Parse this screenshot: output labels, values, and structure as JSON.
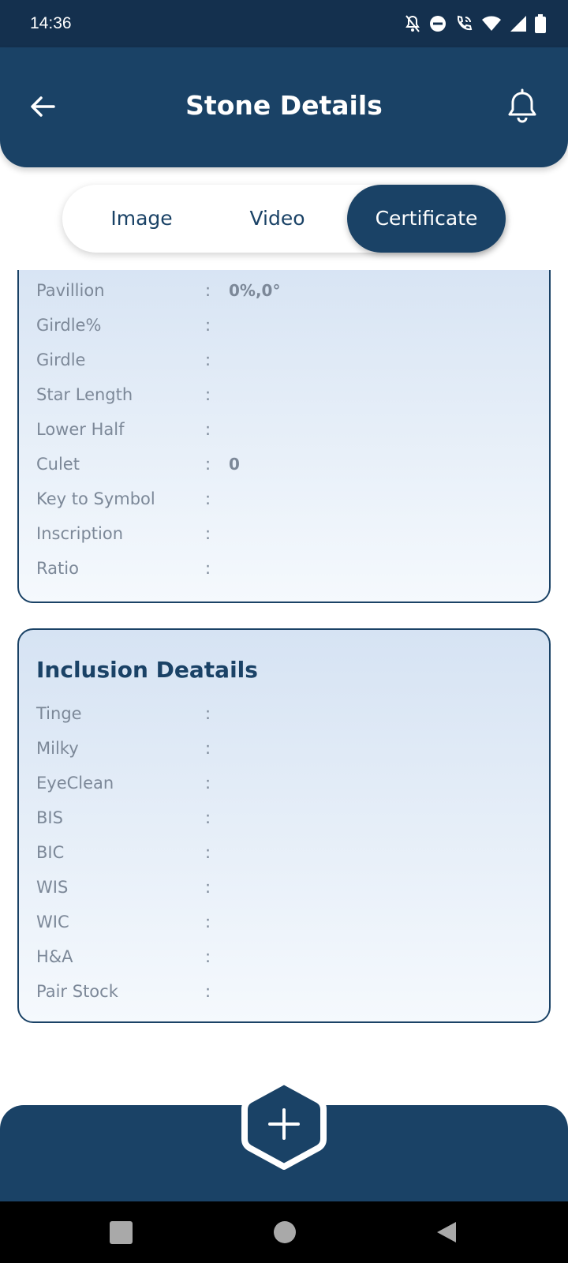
{
  "status_bar": {
    "time": "14:36",
    "icons": [
      "bell-off-icon",
      "do-not-disturb-icon",
      "wifi-call-icon",
      "wifi-icon",
      "cell-signal-icon",
      "battery-icon"
    ]
  },
  "header": {
    "title": "Stone Details",
    "back_icon": "arrow-left-icon",
    "notification_icon": "bell-icon"
  },
  "tabs": {
    "items": [
      {
        "label": "Image",
        "selected": false
      },
      {
        "label": "Video",
        "selected": false
      },
      {
        "label": "Certificate",
        "selected": true
      }
    ]
  },
  "measurements_card": {
    "rows": [
      {
        "label": "Pavillion",
        "colon": ":",
        "value": "0%,0°"
      },
      {
        "label": "Girdle%",
        "colon": ":",
        "value": ""
      },
      {
        "label": "Girdle",
        "colon": ":",
        "value": ""
      },
      {
        "label": "Star Length",
        "colon": ":",
        "value": ""
      },
      {
        "label": "Lower Half",
        "colon": ":",
        "value": ""
      },
      {
        "label": "Culet",
        "colon": ":",
        "value": "0"
      },
      {
        "label": "Key to Symbol",
        "colon": ":",
        "value": ""
      },
      {
        "label": "Inscription",
        "colon": ":",
        "value": ""
      },
      {
        "label": "Ratio",
        "colon": ":",
        "value": ""
      }
    ]
  },
  "inclusion_card": {
    "title": "Inclusion Deatails",
    "rows": [
      {
        "label": "Tinge",
        "colon": ":",
        "value": ""
      },
      {
        "label": "Milky",
        "colon": ":",
        "value": ""
      },
      {
        "label": "EyeClean",
        "colon": ":",
        "value": ""
      },
      {
        "label": "BIS",
        "colon": ":",
        "value": ""
      },
      {
        "label": "BIC",
        "colon": ":",
        "value": ""
      },
      {
        "label": "WIS",
        "colon": ":",
        "value": ""
      },
      {
        "label": "WIC",
        "colon": ":",
        "value": ""
      },
      {
        "label": "H&A",
        "colon": ":",
        "value": ""
      },
      {
        "label": "Pair Stock",
        "colon": ":",
        "value": ""
      }
    ]
  },
  "bottom_bar": {
    "fab_icon": "plus-icon"
  },
  "colors": {
    "primary": "#1a4266",
    "status_bar": "#14304e",
    "label_gray": "#7c8898"
  }
}
